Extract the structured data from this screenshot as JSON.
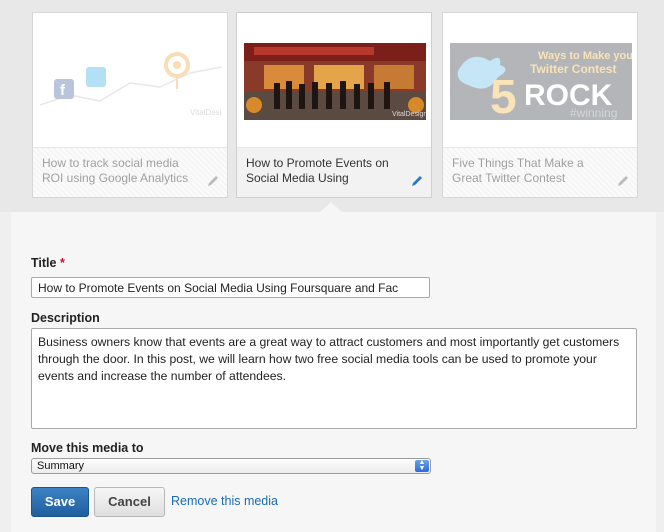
{
  "cards": [
    {
      "caption": "How to track social media ROI using Google Analytics",
      "state": "inactive",
      "thumb_icon": "analytics-chart-icon"
    },
    {
      "caption": "How to Promote Events on Social Media Using",
      "state": "active",
      "thumb_icon": "storefront-photo"
    },
    {
      "caption": "Five Things That Make a Great Twitter Contest",
      "state": "inactive",
      "thumb_icon": "twitter-contest-graphic"
    }
  ],
  "thumb_text": {
    "vital_design": "VitalDesign",
    "contest_line1": "Ways to Make your",
    "contest_line2": "Twitter Contest",
    "contest_number": "5",
    "contest_rock": "ROCK",
    "contest_tag": "#winning"
  },
  "form": {
    "title_label": "Title",
    "required_mark": "*",
    "title_value": "How to Promote Events on Social Media Using Foursquare and Fac",
    "description_label": "Description",
    "description_value": "Business owners know that events are a great way to attract customers and most importantly get customers through the door. In this post, we will learn how two free social media tools can be used to promote your events and increase the number of attendees.",
    "move_label": "Move this media to",
    "move_selected": "Summary",
    "save_label": "Save",
    "cancel_label": "Cancel",
    "remove_label": "Remove this media"
  },
  "colors": {
    "primary": "#2a6fb0",
    "link": "#1a6bb8",
    "required": "#c8102e"
  }
}
